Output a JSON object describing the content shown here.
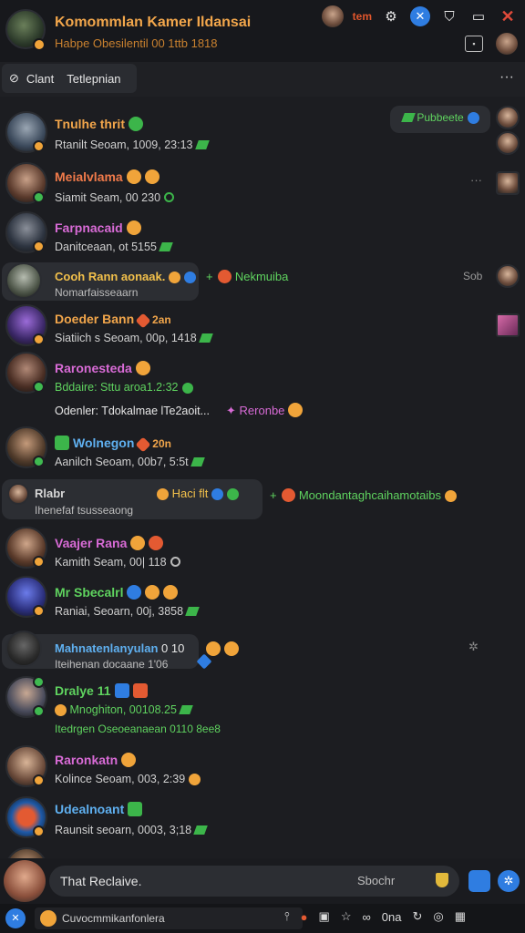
{
  "header": {
    "title": "Komommlan Kamer Ildansai",
    "subtitle": "Habpe Obesilentil  00 1ttb 1818",
    "badge_text": "tem"
  },
  "tabs": {
    "active_icon": "clock-icon",
    "tab1": "Clant",
    "tab2": "Tetlepnian",
    "more": "···"
  },
  "pinned": {
    "label": "Pubbeete"
  },
  "chats": [
    {
      "name": "Tnulhe thrit",
      "name_color": "#f2a64b",
      "preview": "Rtanilt Seoam, 1009, 23:13"
    },
    {
      "name": "Meialvlama",
      "name_color": "#f07a4a",
      "preview": "Siamit Seam, 00 230"
    },
    {
      "name": "Farpnacaid",
      "name_color": "#d86bd6",
      "preview": "Danitceaan, ot 5155"
    },
    {
      "name": "Cooh Rann aonaak.",
      "name_color": "#f2c04b",
      "preview": "Nomarfaisseaarn",
      "reply": "Nekmuiba",
      "side_text": "Sob"
    },
    {
      "name": "Doeder Bann",
      "name_color": "#f2a64b",
      "name_suffix": "2an",
      "preview": "Siatiich s Seoam, 00p, 1418"
    },
    {
      "name": "Raronesteda",
      "name_color": "#d86bd6",
      "preview": "Bddaire:  Sttu aroa1.2:32",
      "extra_left": "Odenler: Tdokalmae lTe2aoit...",
      "extra_right": "Reronbe"
    },
    {
      "name": "Wolnegon",
      "name_color": "#5fb0f0",
      "name_suffix": "20n",
      "preview": "Aanilch Seoam, 00b7, 5:5t"
    },
    {
      "name": "Rlabr",
      "name_color": "#e8e8e8",
      "preview": "Ihenefaf tsusseaong",
      "bubble_label": "Haci flt",
      "reply": "Moondantaghcaihamotaibs"
    },
    {
      "name": "Vaajer Rana",
      "name_color": "#d86bd6",
      "preview": "Kamith Seam, 00| 118"
    },
    {
      "name": "Mr Sbecalrl",
      "name_color": "#5fd35f",
      "preview": "Raniai, Seoarn, 00j, 3858"
    },
    {
      "name": "Mahnatenlanyulan",
      "name_color": "#5fb0f0",
      "name_suffix": "0 10",
      "preview": "Iteihenan docaane 1'06"
    },
    {
      "name": "Dralye 11",
      "name_color": "#5fd35f",
      "preview": "Mnoghiton,  00108.25",
      "preview2": "Itedrgen Oseoeanaean  0110 8ee8"
    },
    {
      "name": "Raronkatn",
      "name_color": "#d86bd6",
      "preview": "Kolince Seoam, 003, 2:39"
    },
    {
      "name": "Udealnoant",
      "name_color": "#5fb0f0",
      "preview": "Raunsit seoarn, 0003, 3;18"
    }
  ],
  "compose": {
    "placeholder": "That Reclaive.",
    "search_label": "Sbochr"
  },
  "bottom": {
    "field_text": "Cuvocmmikanfonlera",
    "icon_text": "0na"
  }
}
